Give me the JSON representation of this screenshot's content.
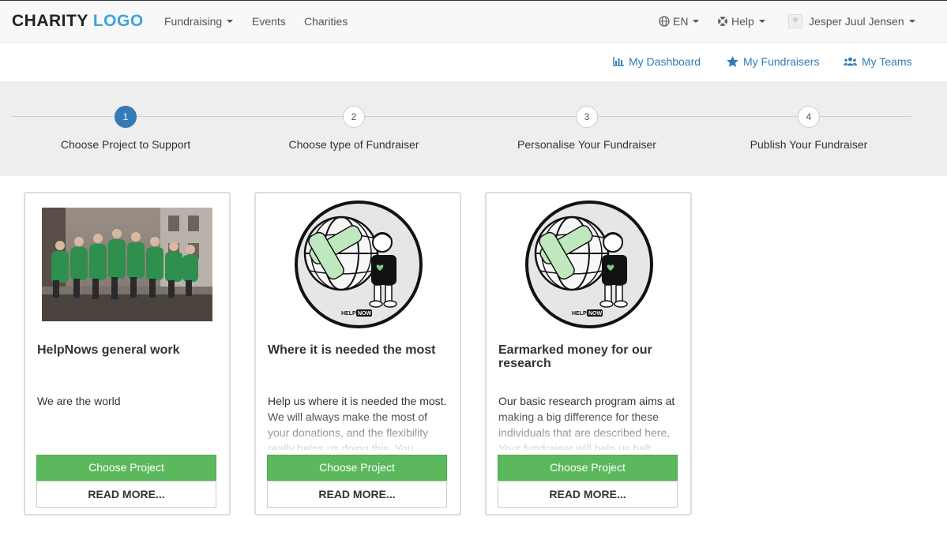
{
  "brand": {
    "logo_part1": "CHARITY",
    "logo_part2": "LOGO",
    "accent_color": "#3ea3d8"
  },
  "navbar": {
    "fundraising_label": "Fundraising",
    "events_label": "Events",
    "charities_label": "Charities",
    "language_label": "EN",
    "help_label": "Help",
    "user_name": "Jesper Juul Jensen"
  },
  "subnav": {
    "dashboard_label": "My Dashboard",
    "fundraisers_label": "My Fundraisers",
    "teams_label": "My Teams",
    "link_color": "#337ab7"
  },
  "steps": [
    {
      "number": "1",
      "label": "Choose Project to Support",
      "active": true
    },
    {
      "number": "2",
      "label": "Choose type of Fundraiser",
      "active": false
    },
    {
      "number": "3",
      "label": "Personalise Your Fundraiser",
      "active": false
    },
    {
      "number": "4",
      "label": "Publish Your Fundraiser",
      "active": false
    }
  ],
  "projects": [
    {
      "title": "HelpNows general work",
      "description": "We are the world",
      "image": "group-photo",
      "choose_label": "Choose Project",
      "read_more_label": "READ MORE..."
    },
    {
      "title": "Where it is needed the most",
      "description": "Help us where it is needed the most. We will always make the most of your donations, and the flexibility really helps us doing this. You",
      "image": "helpnow-logo",
      "logo_text_a": "HELP",
      "logo_text_b": "NOW",
      "choose_label": "Choose Project",
      "read_more_label": "READ MORE..."
    },
    {
      "title": "Earmarked money for our research",
      "description": "Our basic research program aims at making a big difference for these individuals that are described here, Your fundraiser will help us helt",
      "image": "helpnow-logo",
      "logo_text_a": "HELP",
      "logo_text_b": "NOW",
      "choose_label": "Choose Project",
      "read_more_label": "READ MORE..."
    }
  ],
  "colors": {
    "primary": "#337ab7",
    "success": "#5cb85c",
    "step_bg": "#eeeeee"
  }
}
